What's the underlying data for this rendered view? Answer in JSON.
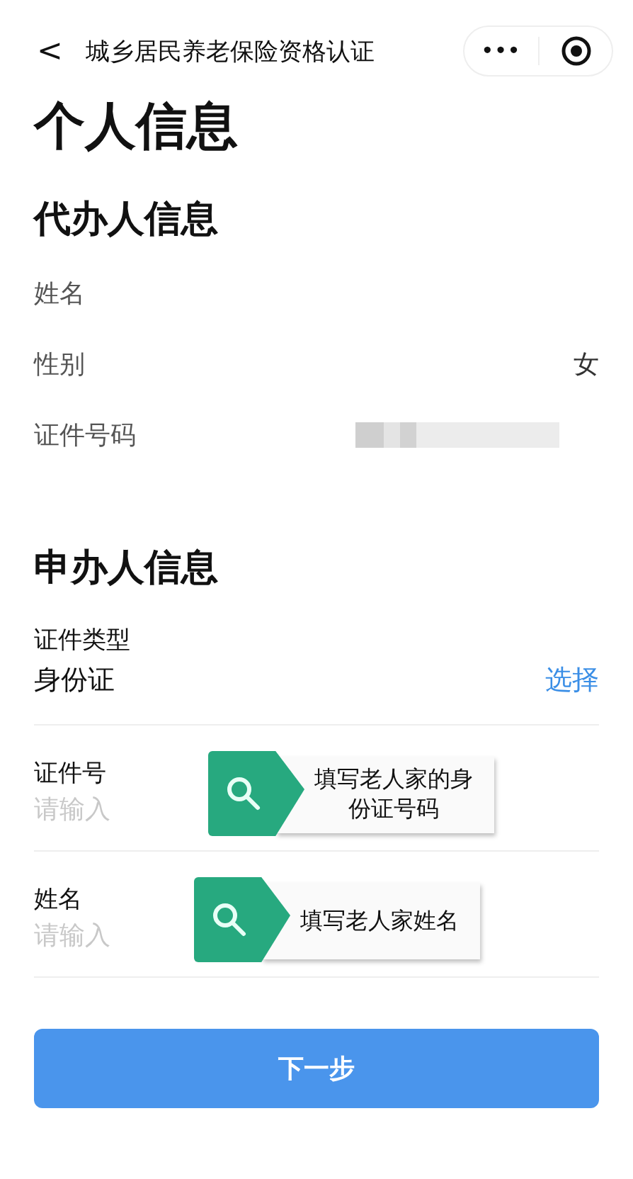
{
  "nav": {
    "back": "<",
    "title": "城乡居民养老保险资格认证",
    "more": "•••"
  },
  "page_title": "个人信息",
  "agent": {
    "heading": "代办人信息",
    "rows": [
      {
        "label": "姓名",
        "kind": "empty"
      },
      {
        "label": "性别",
        "kind": "text",
        "value": "女"
      },
      {
        "label": "证件号码",
        "kind": "redacted"
      }
    ]
  },
  "applicant": {
    "heading": "申办人信息",
    "id_type": {
      "label": "证件类型",
      "value": "身份证",
      "action": "选择"
    },
    "fields": [
      {
        "label": "证件号",
        "placeholder": "请输入",
        "callout": "填写老人家的身份证号码"
      },
      {
        "label": "姓名",
        "placeholder": "请输入",
        "callout": "填写老人家姓名"
      }
    ]
  },
  "next_button": "下一步"
}
